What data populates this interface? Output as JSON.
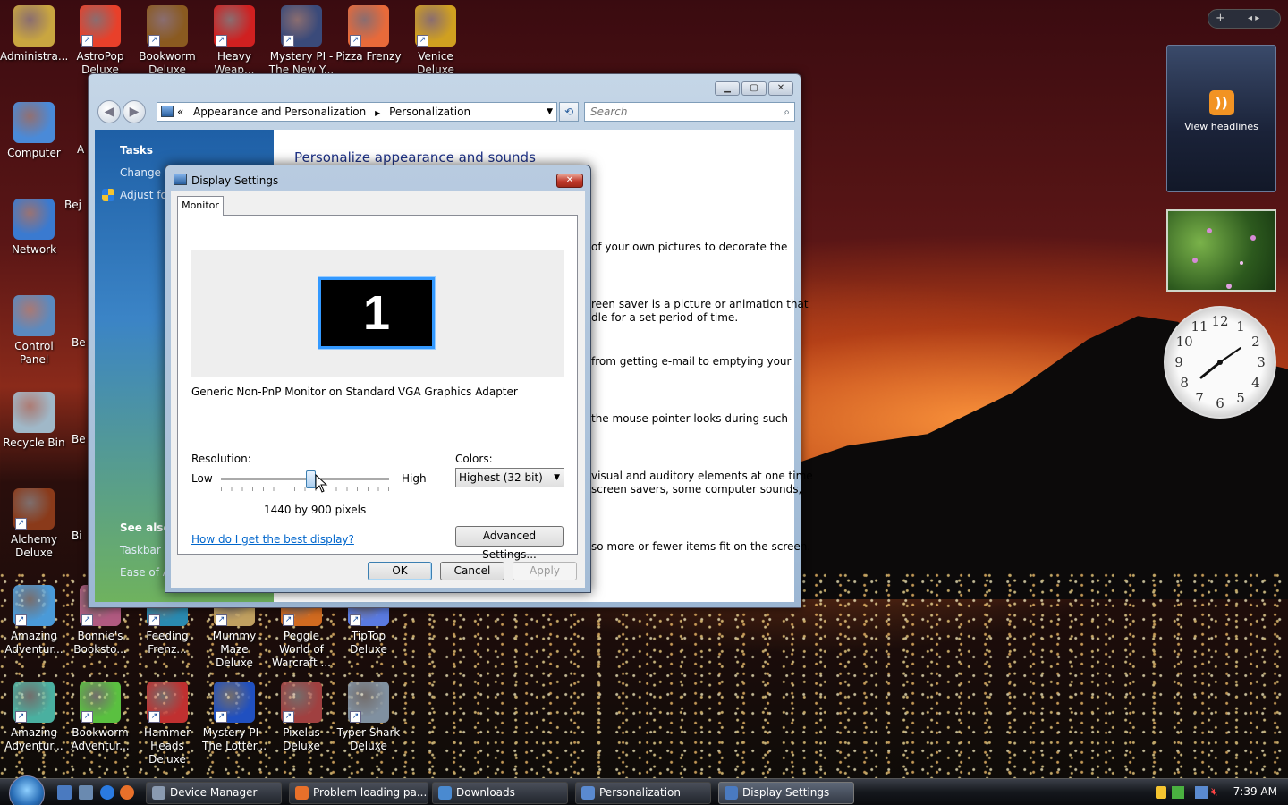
{
  "desktop": {
    "icons": [
      {
        "id": "administrator",
        "label": "Administra...",
        "color": "#c9a640"
      },
      {
        "id": "astropop",
        "label": "AstroPop Deluxe",
        "color": "#e8402a"
      },
      {
        "id": "bookworm",
        "label": "Bookworm Deluxe",
        "color": "#8a5a20"
      },
      {
        "id": "heavy-weapon",
        "label": "Heavy Weap...",
        "color": "#d02020"
      },
      {
        "id": "mystery-pi-new-york",
        "label": "Mystery PI - The New Y...",
        "color": "#3a4a7a"
      },
      {
        "id": "pizza-frenzy",
        "label": "Pizza Frenzy",
        "color": "#e86a3a"
      },
      {
        "id": "venice",
        "label": "Venice Deluxe",
        "color": "#d0a020"
      },
      {
        "id": "computer",
        "label": "Computer",
        "color": "#4a8ad8"
      },
      {
        "id": "network",
        "label": "Network",
        "color": "#3a7ad0"
      },
      {
        "id": "control-panel",
        "label": "Control Panel",
        "color": "#5a8ac0"
      },
      {
        "id": "recycle-bin",
        "label": "Recycle Bin",
        "color": "#a0b8c8"
      },
      {
        "id": "alchemy",
        "label": "Alchemy Deluxe",
        "color": "#8a3a1a"
      },
      {
        "id": "amazing-adventures-1",
        "label": "Amazing Adventur...",
        "color": "#4a9ad8"
      },
      {
        "id": "bonnies-bookstore",
        "label": "Bonnie's Booksto...",
        "color": "#b05a80"
      },
      {
        "id": "feeding-frenzy",
        "label": "Feeding Frenz...",
        "color": "#2a8ab0"
      },
      {
        "id": "mummy-maze",
        "label": "Mummy Maze Deluxe",
        "color": "#c0a060"
      },
      {
        "id": "peggle-world-of-warcraft",
        "label": "Peggle World of Warcraft ...",
        "color": "#d06a20"
      },
      {
        "id": "tiptop",
        "label": "TipTop Deluxe",
        "color": "#5a7ae0"
      },
      {
        "id": "amazing-adventures-2",
        "label": "Amazing Adventur...",
        "color": "#4ab0a0"
      },
      {
        "id": "bookworm-adventures",
        "label": "Bookworm Adventur...",
        "color": "#5ac040"
      },
      {
        "id": "hammer-heads",
        "label": "Hammer Heads Deluxe",
        "color": "#c03030"
      },
      {
        "id": "mystery-pi-lottery",
        "label": "Mystery PI - The Lotter...",
        "color": "#2050c0"
      },
      {
        "id": "pixelus",
        "label": "Pixelus Deluxe",
        "color": "#a04040"
      },
      {
        "id": "typer-shark",
        "label": "Typer Shark Deluxe",
        "color": "#8090a0"
      }
    ],
    "partial_icons": [
      "Bej",
      "Be",
      "Be",
      "Bi",
      "A"
    ]
  },
  "gadgets": {
    "rss_label": "View headlines",
    "rss_icon": "rss-icon",
    "clock_numbers": [
      "12",
      "1",
      "2",
      "3",
      "4",
      "5",
      "6",
      "7",
      "8",
      "9",
      "10",
      "11"
    ],
    "topbar_add": "+",
    "topbar_nav": "◂ ▸"
  },
  "personalization_window": {
    "breadcrumb_prefix": "«",
    "breadcrumb": [
      "Appearance and Personalization",
      "Personalization"
    ],
    "search_placeholder": "Search",
    "title": "Personalize appearance and sounds",
    "tasks_heading": "Tasks",
    "tasks": [
      "Change d",
      "Adjust fon"
    ],
    "see_also_heading": "See also",
    "see_also": [
      "Taskbar a",
      "Ease of Ac"
    ],
    "content_fragments": [
      {
        "line1": "of your own pictures to decorate the",
        "line2": ""
      },
      {
        "line1": "reen saver is a picture or animation that",
        "line2": "dle for a set period of time."
      },
      {
        "line1": "from getting e-mail to emptying your",
        "line2": ""
      },
      {
        "line1": "the mouse pointer looks during such",
        "line2": ""
      },
      {
        "line1": "visual and auditory elements at one time",
        "line2": "screen savers, some computer sounds,"
      },
      {
        "line1": "so more or fewer items fit on the screen.",
        "line2": ""
      }
    ]
  },
  "display_settings": {
    "title": "Display Settings",
    "tab": "Monitor",
    "monitor_number": "1",
    "monitor_name": "Generic Non-PnP Monitor on Standard VGA Graphics Adapter",
    "resolution_label": "Resolution:",
    "low_label": "Low",
    "high_label": "High",
    "resolution_value": "1440 by 900 pixels",
    "resolution_slider_fraction": 0.53,
    "colors_label": "Colors:",
    "colors_value": "Highest (32 bit)",
    "help_link": "How do I get the best display?",
    "advanced_button": "Advanced Settings...",
    "ok": "OK",
    "cancel": "Cancel",
    "apply": "Apply"
  },
  "taskbar": {
    "buttons": [
      {
        "label": "Device Manager",
        "icon": "device-manager-icon",
        "color": "#8a9ab0"
      },
      {
        "label": "Problem loading pa...",
        "icon": "firefox-icon",
        "color": "#e8702a"
      },
      {
        "label": "Downloads",
        "icon": "downloads-icon",
        "color": "#4a8ad0"
      },
      {
        "label": "Personalization",
        "icon": "personalization-icon",
        "color": "#5a8ad0"
      },
      {
        "label": "Display Settings",
        "icon": "display-settings-icon",
        "color": "#4a7ac0"
      }
    ],
    "active_index": 4,
    "time": "7:39 AM"
  }
}
